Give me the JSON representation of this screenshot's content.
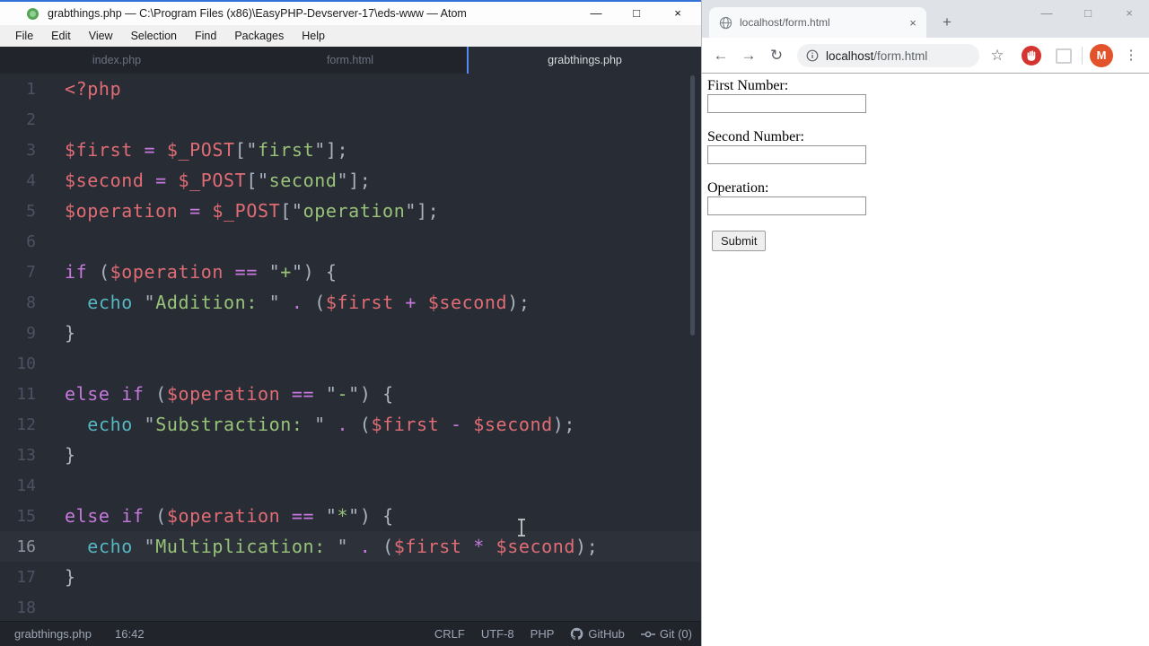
{
  "colors": {
    "editor_bg": "#282c34",
    "panel_bg": "#21252b",
    "accent_blue": "#568af2",
    "tok_default": "#abb2bf",
    "tok_variable": "#e06c75",
    "tok_keyword": "#c678dd",
    "tok_string": "#98c379",
    "tok_support": "#56b6c2",
    "chrome_icon": "#5f6368",
    "adblock_red": "#d4332f",
    "avatar_orange": "#e2532c"
  },
  "icons": {
    "minimize": "—",
    "maximize": "□",
    "close": "×",
    "tab_close": "×",
    "new_tab": "+",
    "back": "←",
    "forward": "→",
    "reload": "↻",
    "star": "☆",
    "menu_dots": "⋮"
  },
  "atom": {
    "title": "grabthings.php — C:\\Program Files (x86)\\EasyPHP-Devserver-17\\eds-www — Atom",
    "menu": [
      "File",
      "Edit",
      "View",
      "Selection",
      "Find",
      "Packages",
      "Help"
    ],
    "tabs": [
      {
        "label": "index.php",
        "active": false
      },
      {
        "label": "form.html",
        "active": false
      },
      {
        "label": "grabthings.php",
        "active": true
      }
    ],
    "code": {
      "active_line": 16,
      "lines": [
        {
          "n": "1",
          "tokens": [
            [
              "<?php",
              "r"
            ]
          ]
        },
        {
          "n": "2",
          "tokens": []
        },
        {
          "n": "3",
          "tokens": [
            [
              "$first",
              "r"
            ],
            [
              " ",
              "w"
            ],
            [
              "=",
              "p"
            ],
            [
              " ",
              "w"
            ],
            [
              "$_POST",
              "r"
            ],
            [
              "[",
              "w"
            ],
            [
              "\"",
              "w"
            ],
            [
              "first",
              "g"
            ],
            [
              "\"",
              "w"
            ],
            [
              "];",
              "w"
            ]
          ]
        },
        {
          "n": "4",
          "tokens": [
            [
              "$second",
              "r"
            ],
            [
              " ",
              "w"
            ],
            [
              "=",
              "p"
            ],
            [
              " ",
              "w"
            ],
            [
              "$_POST",
              "r"
            ],
            [
              "[",
              "w"
            ],
            [
              "\"",
              "w"
            ],
            [
              "second",
              "g"
            ],
            [
              "\"",
              "w"
            ],
            [
              "];",
              "w"
            ]
          ]
        },
        {
          "n": "5",
          "tokens": [
            [
              "$operation",
              "r"
            ],
            [
              " ",
              "w"
            ],
            [
              "=",
              "p"
            ],
            [
              " ",
              "w"
            ],
            [
              "$_POST",
              "r"
            ],
            [
              "[",
              "w"
            ],
            [
              "\"",
              "w"
            ],
            [
              "operation",
              "g"
            ],
            [
              "\"",
              "w"
            ],
            [
              "];",
              "w"
            ]
          ]
        },
        {
          "n": "6",
          "tokens": []
        },
        {
          "n": "7",
          "tokens": [
            [
              "if",
              "p"
            ],
            [
              " (",
              "w"
            ],
            [
              "$operation",
              "r"
            ],
            [
              " ",
              "w"
            ],
            [
              "==",
              "p"
            ],
            [
              " ",
              "w"
            ],
            [
              "\"",
              "w"
            ],
            [
              "+",
              "g"
            ],
            [
              "\"",
              "w"
            ],
            [
              ") {",
              "w"
            ]
          ]
        },
        {
          "n": "8",
          "tokens": [
            [
              "  ",
              "w"
            ],
            [
              "echo",
              "c"
            ],
            [
              " ",
              "w"
            ],
            [
              "\"",
              "w"
            ],
            [
              "Addition: ",
              "g"
            ],
            [
              "\"",
              "w"
            ],
            [
              " ",
              "w"
            ],
            [
              ".",
              "p"
            ],
            [
              " (",
              "w"
            ],
            [
              "$first",
              "r"
            ],
            [
              " ",
              "w"
            ],
            [
              "+",
              "p"
            ],
            [
              " ",
              "w"
            ],
            [
              "$second",
              "r"
            ],
            [
              ");",
              "w"
            ]
          ]
        },
        {
          "n": "9",
          "tokens": [
            [
              "}",
              "w"
            ]
          ]
        },
        {
          "n": "10",
          "tokens": []
        },
        {
          "n": "11",
          "tokens": [
            [
              "else",
              "p"
            ],
            [
              " ",
              "w"
            ],
            [
              "if",
              "p"
            ],
            [
              " (",
              "w"
            ],
            [
              "$operation",
              "r"
            ],
            [
              " ",
              "w"
            ],
            [
              "==",
              "p"
            ],
            [
              " ",
              "w"
            ],
            [
              "\"",
              "w"
            ],
            [
              "-",
              "g"
            ],
            [
              "\"",
              "w"
            ],
            [
              ") {",
              "w"
            ]
          ]
        },
        {
          "n": "12",
          "tokens": [
            [
              "  ",
              "w"
            ],
            [
              "echo",
              "c"
            ],
            [
              " ",
              "w"
            ],
            [
              "\"",
              "w"
            ],
            [
              "Substraction: ",
              "g"
            ],
            [
              "\"",
              "w"
            ],
            [
              " ",
              "w"
            ],
            [
              ".",
              "p"
            ],
            [
              " (",
              "w"
            ],
            [
              "$first",
              "r"
            ],
            [
              " ",
              "w"
            ],
            [
              "-",
              "p"
            ],
            [
              " ",
              "w"
            ],
            [
              "$second",
              "r"
            ],
            [
              ");",
              "w"
            ]
          ]
        },
        {
          "n": "13",
          "tokens": [
            [
              "}",
              "w"
            ]
          ]
        },
        {
          "n": "14",
          "tokens": []
        },
        {
          "n": "15",
          "tokens": [
            [
              "else",
              "p"
            ],
            [
              " ",
              "w"
            ],
            [
              "if",
              "p"
            ],
            [
              " (",
              "w"
            ],
            [
              "$operation",
              "r"
            ],
            [
              " ",
              "w"
            ],
            [
              "==",
              "p"
            ],
            [
              " ",
              "w"
            ],
            [
              "\"",
              "w"
            ],
            [
              "*",
              "g"
            ],
            [
              "\"",
              "w"
            ],
            [
              ") {",
              "w"
            ]
          ]
        },
        {
          "n": "16",
          "tokens": [
            [
              "  ",
              "w"
            ],
            [
              "echo",
              "c"
            ],
            [
              " ",
              "w"
            ],
            [
              "\"",
              "w"
            ],
            [
              "Multiplication: ",
              "g"
            ],
            [
              "\"",
              "w"
            ],
            [
              " ",
              "w"
            ],
            [
              ".",
              "p"
            ],
            [
              " (",
              "w"
            ],
            [
              "$first",
              "r"
            ],
            [
              " ",
              "w"
            ],
            [
              "*",
              "p"
            ],
            [
              " ",
              "w"
            ],
            [
              "$second",
              "r"
            ],
            [
              ");",
              "w"
            ]
          ]
        },
        {
          "n": "17",
          "tokens": [
            [
              "}",
              "w"
            ]
          ]
        },
        {
          "n": "18",
          "tokens": []
        }
      ]
    },
    "status": {
      "file": "grabthings.php",
      "cursor": "16:42",
      "eol": "CRLF",
      "encoding": "UTF-8",
      "language": "PHP",
      "github": "GitHub",
      "git": "Git (0)"
    }
  },
  "browser": {
    "tab_title": "localhost/form.html",
    "url_host": "localhost",
    "url_path": "/form.html",
    "avatar_letter": "M",
    "form": {
      "fields": [
        {
          "label": "First Number:",
          "value": ""
        },
        {
          "label": "Second Number:",
          "value": ""
        },
        {
          "label": "Operation:",
          "value": ""
        }
      ],
      "submit_label": "Submit"
    }
  }
}
